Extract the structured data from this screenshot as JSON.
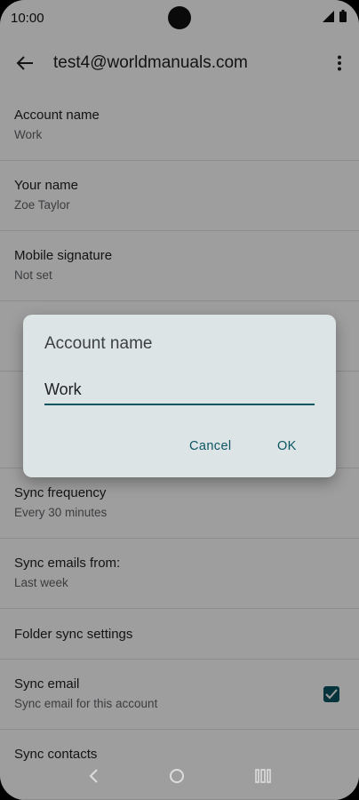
{
  "status": {
    "time": "10:00"
  },
  "app_bar": {
    "title": "test4@worldmanuals.com"
  },
  "settings": {
    "account_name": {
      "label": "Account name",
      "value": "Work"
    },
    "your_name": {
      "label": "Your name",
      "value": "Zoe Taylor"
    },
    "mobile_signature": {
      "label": "Mobile signature",
      "value": "Not set"
    },
    "sync_frequency": {
      "label": "Sync frequency",
      "value": "Every 30 minutes"
    },
    "sync_emails_from": {
      "label": "Sync emails from:",
      "value": "Last week"
    },
    "folder_sync": {
      "label": "Folder sync settings"
    },
    "sync_email": {
      "label": "Sync email",
      "value": "Sync email for this account",
      "checked": true
    },
    "sync_contacts": {
      "label": "Sync contacts"
    }
  },
  "dialog": {
    "title": "Account name",
    "input_value": "Work",
    "cancel_label": "Cancel",
    "ok_label": "OK"
  },
  "colors": {
    "accent": "#0b5563",
    "dialog_bg": "#dde4e6"
  },
  "icons": [
    "back-arrow-icon",
    "more-vert-icon",
    "signal-icon",
    "battery-icon",
    "nav-back-icon",
    "nav-home-icon",
    "nav-recents-icon",
    "check-icon"
  ]
}
